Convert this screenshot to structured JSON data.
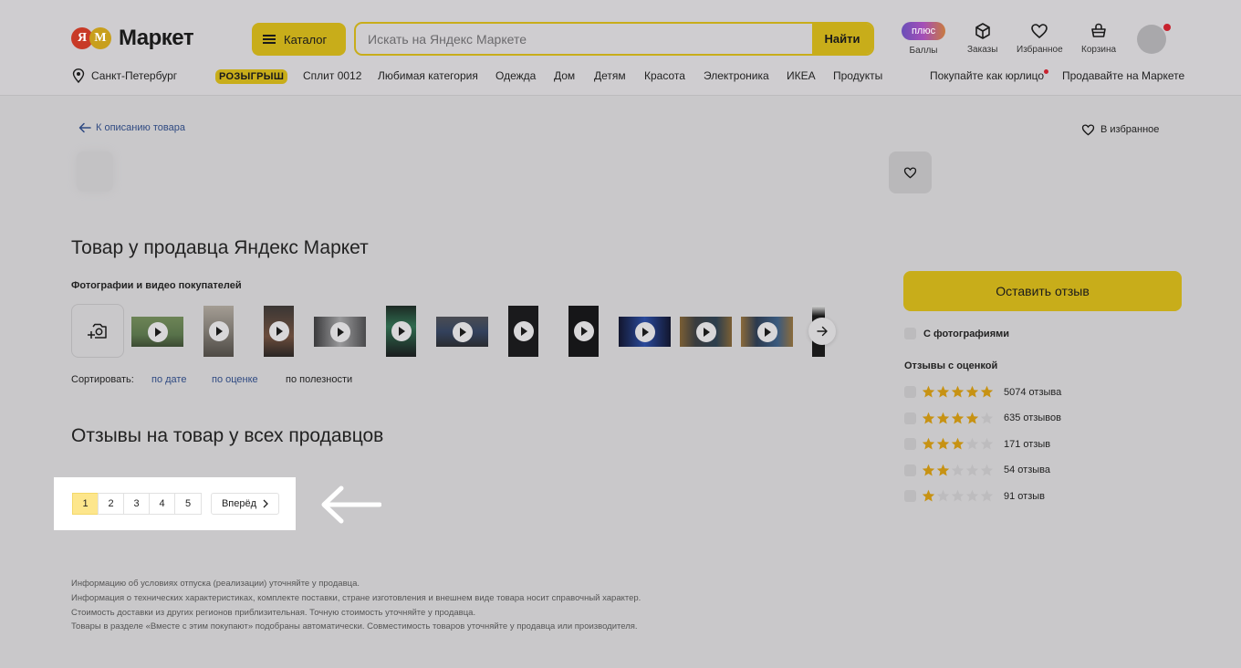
{
  "header": {
    "logo_letters": [
      "Я",
      "M"
    ],
    "logo_word": "Маркет",
    "catalog_label": "Каталог",
    "search_placeholder": "Искать на Яндекс Маркете",
    "search_button": "Найти",
    "plus_badge": "плюс",
    "icons": [
      {
        "name": "points",
        "label": "Баллы"
      },
      {
        "name": "orders",
        "label": "Заказы"
      },
      {
        "name": "favorites",
        "label": "Избранное"
      },
      {
        "name": "cart",
        "label": "Корзина"
      }
    ],
    "location": "Санкт-Петербург",
    "promo": "РОЗЫГРЫШ",
    "nav": [
      "Сплит 0012",
      "Любимая категория",
      "Одежда",
      "Дом",
      "Детям",
      "Красота",
      "Электроника",
      "ИКЕА",
      "Продукты"
    ],
    "right_links": [
      "Покупайте как юрлицо",
      "Продавайте на Маркете"
    ]
  },
  "page": {
    "back_link": "К описанию товара",
    "favorite_link": "В избранное",
    "title": "Товар у продавца Яндекс Маркет",
    "photos_heading": "Фотографии и видео покупателей",
    "sort_label": "Сортировать:",
    "sort_options": [
      "по дате",
      "по оценке",
      "по полезности"
    ],
    "reviews_title": "Отзывы на товар у всех продавцов",
    "pagination": {
      "pages": [
        "1",
        "2",
        "3",
        "4",
        "5"
      ],
      "active": "1",
      "next": "Вперёд"
    },
    "disclaimer": [
      "Информацию об условиях отпуска (реализации) уточняйте у продавца.",
      "Информация о технических характеристиках, комплекте поставки, стране изготовления и внешнем виде товара носит справочный характер.",
      "Стоимость доставки из других регионов приблизительная. Точную стоимость уточняйте у продавца.",
      "Товары в разделе «Вместе с этим покупают» подобраны автоматически. Совместимость товаров уточняйте у продавца или производителя."
    ]
  },
  "sidebar": {
    "leave_review": "Оставить отзыв",
    "with_photos": "С фотографиями",
    "ratings_heading": "Отзывы с оценкой",
    "ratings": [
      {
        "stars": 5,
        "count": "5074 отзыва"
      },
      {
        "stars": 4,
        "count": "635 отзывов"
      },
      {
        "stars": 3,
        "count": "171 отзыв"
      },
      {
        "stars": 2,
        "count": "54 отзыва"
      },
      {
        "stars": 1,
        "count": "91 отзыв"
      }
    ]
  },
  "colors": {
    "accent_yellow": "#c8ad1a",
    "link_blue": "#2f4a82",
    "star_gold": "#c79213",
    "star_empty": "#bdbcbe",
    "active_page": "#fde68c"
  }
}
